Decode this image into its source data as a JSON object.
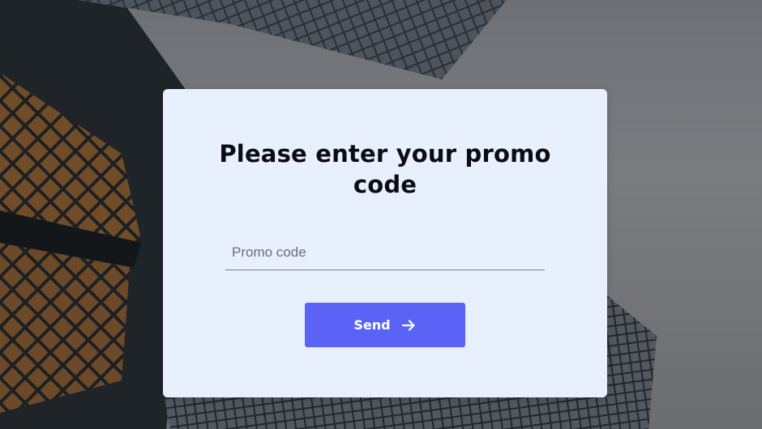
{
  "promo_dialog": {
    "title": "Please enter your promo code",
    "input": {
      "placeholder": "Promo code",
      "value": ""
    },
    "send_button": {
      "label": "Send",
      "icon": "arrow-right-icon"
    }
  },
  "colors": {
    "card_background": "#e8f0fe",
    "button_accent": "#5a63f5",
    "title_text": "#0b0d12"
  },
  "background": {
    "description_icon": "skyscraper-photo"
  }
}
